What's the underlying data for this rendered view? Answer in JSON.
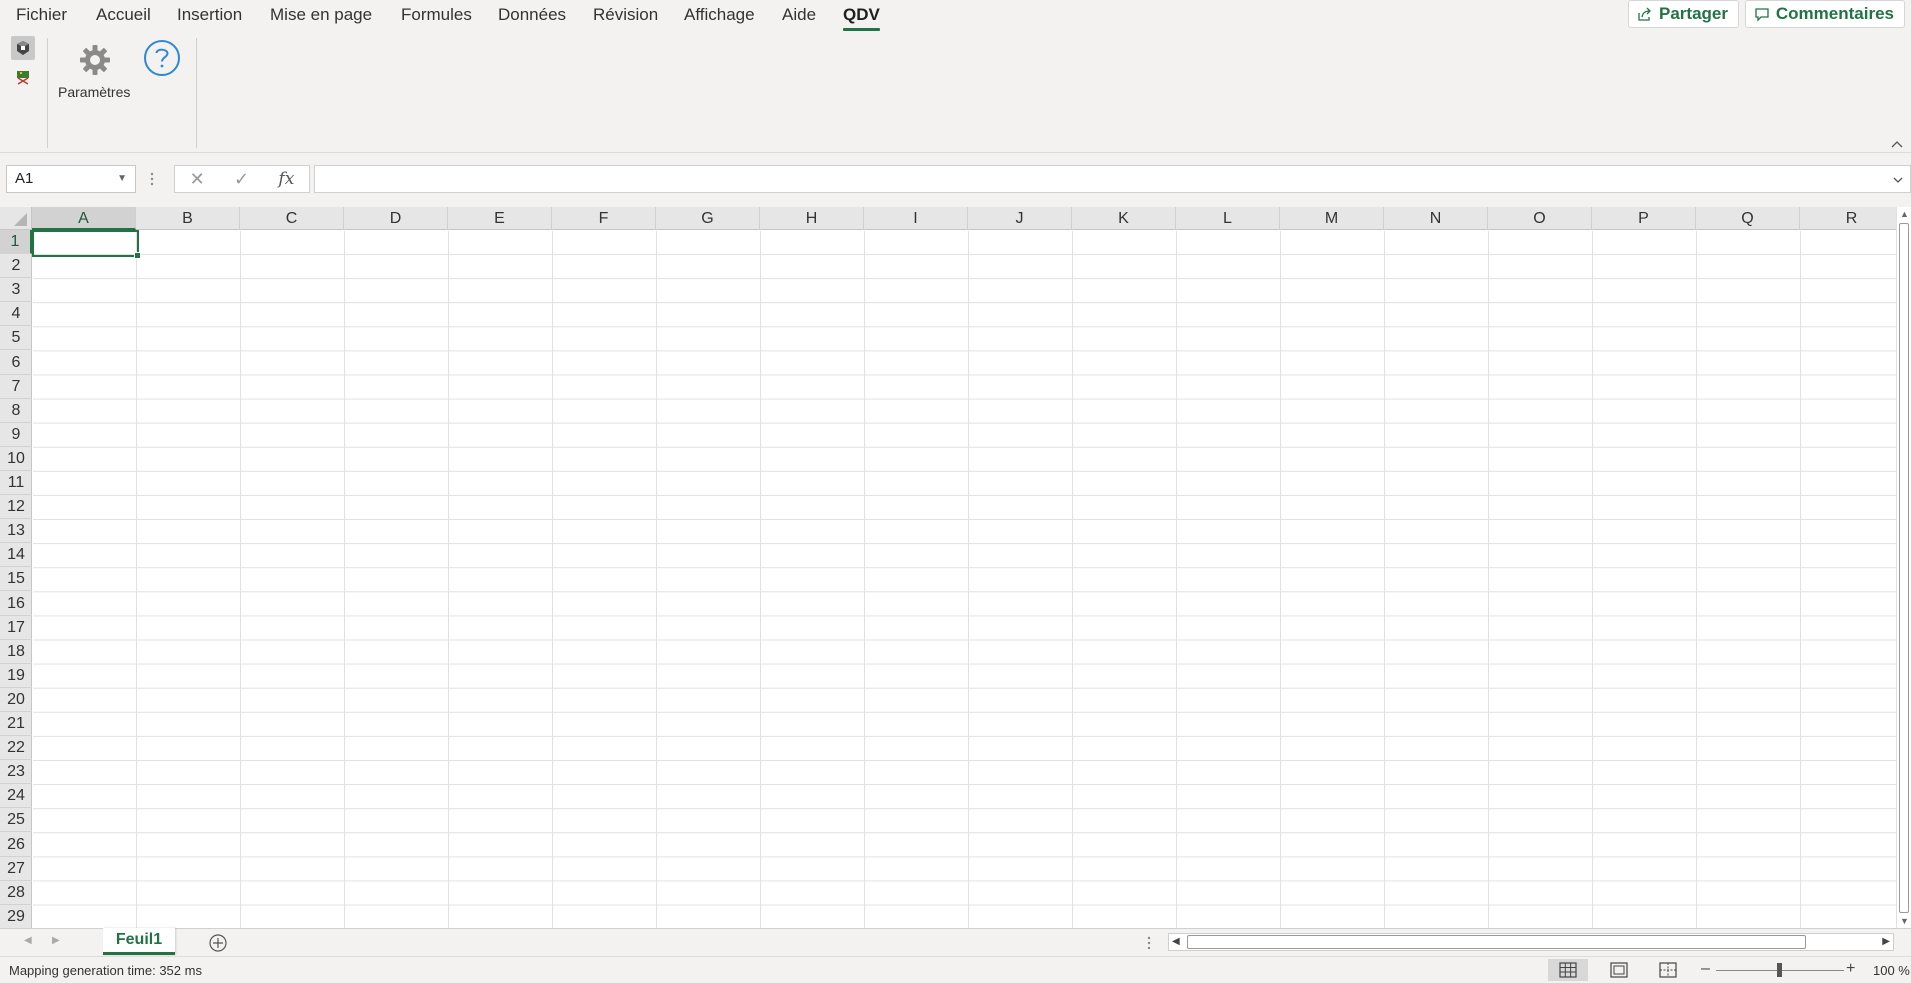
{
  "ribbon": {
    "tabs": [
      {
        "label": "Fichier",
        "active": false
      },
      {
        "label": "Accueil",
        "active": false
      },
      {
        "label": "Insertion",
        "active": false
      },
      {
        "label": "Mise en page",
        "active": false
      },
      {
        "label": "Formules",
        "active": false
      },
      {
        "label": "Données",
        "active": false
      },
      {
        "label": "Révision",
        "active": false
      },
      {
        "label": "Affichage",
        "active": false
      },
      {
        "label": "Aide",
        "active": false
      },
      {
        "label": "QDV",
        "active": true
      }
    ],
    "share_label": "Partager",
    "comments_label": "Commentaires",
    "settings_label": "Paramètres",
    "icons": {
      "small_1": "cube-icon",
      "small_2": "map-tool-icon",
      "settings": "gear-icon",
      "help": "help-circle-icon"
    }
  },
  "formula_bar": {
    "name_box": "A1",
    "fx_label": "fx",
    "formula_value": ""
  },
  "grid": {
    "columns": [
      "A",
      "B",
      "C",
      "D",
      "E",
      "F",
      "G",
      "H",
      "I",
      "J",
      "K",
      "L",
      "M",
      "N",
      "O",
      "P",
      "Q",
      "R"
    ],
    "rows": [
      "1",
      "2",
      "3",
      "4",
      "5",
      "6",
      "7",
      "8",
      "9",
      "10",
      "11",
      "12",
      "13",
      "14",
      "15",
      "16",
      "17",
      "18",
      "19",
      "20",
      "21",
      "22",
      "23",
      "24",
      "25",
      "26",
      "27",
      "28",
      "29"
    ],
    "active_cell": "A1"
  },
  "sheets": [
    {
      "name": "Feuil1",
      "active": true
    }
  ],
  "status": {
    "message": "Mapping generation time: 352 ms",
    "zoom": "100 %",
    "zoom_percent": 100
  },
  "colors": {
    "accent": "#217346",
    "ribbon_bg": "#f3f2f1",
    "header_bg": "#e6e6e6",
    "help_blue": "#2b88d8"
  }
}
